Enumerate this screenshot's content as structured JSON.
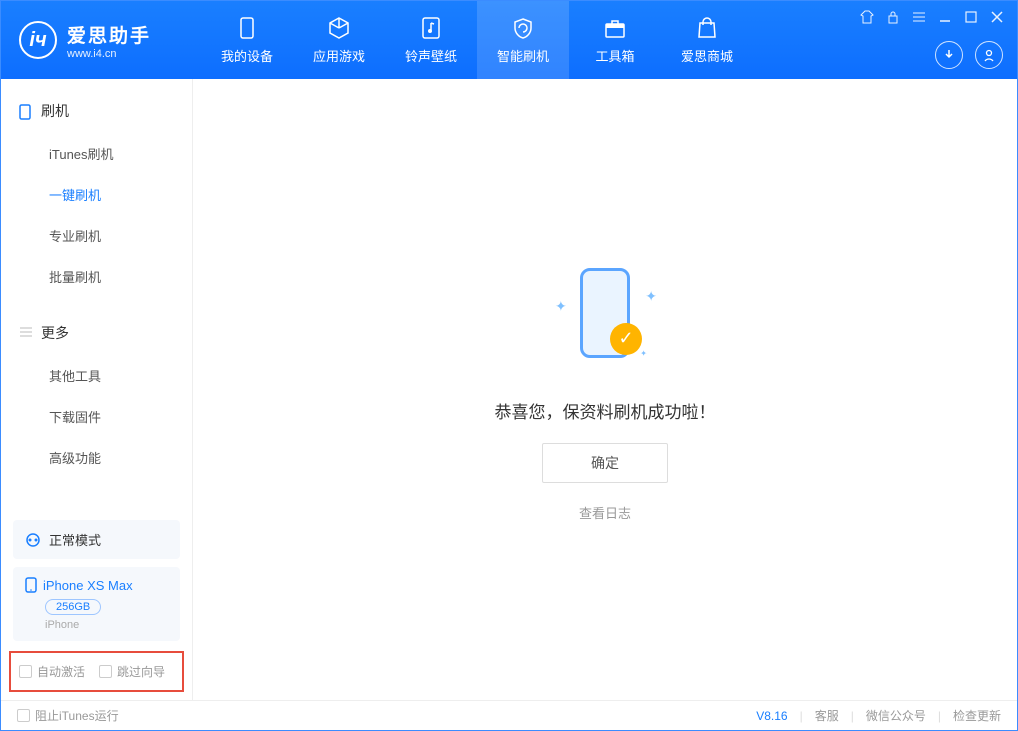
{
  "app": {
    "title": "爱思助手",
    "subtitle": "www.i4.cn"
  },
  "tabs": [
    {
      "label": "我的设备"
    },
    {
      "label": "应用游戏"
    },
    {
      "label": "铃声壁纸"
    },
    {
      "label": "智能刷机"
    },
    {
      "label": "工具箱"
    },
    {
      "label": "爱思商城"
    }
  ],
  "sidebar": {
    "section1": {
      "title": "刷机",
      "items": [
        {
          "label": "iTunes刷机"
        },
        {
          "label": "一键刷机"
        },
        {
          "label": "专业刷机"
        },
        {
          "label": "批量刷机"
        }
      ]
    },
    "section2": {
      "title": "更多",
      "items": [
        {
          "label": "其他工具"
        },
        {
          "label": "下载固件"
        },
        {
          "label": "高级功能"
        }
      ]
    },
    "mode": "正常模式",
    "device": {
      "name": "iPhone XS Max",
      "capacity": "256GB",
      "type": "iPhone"
    },
    "options": {
      "auto_activate": "自动激活",
      "skip_guide": "跳过向导"
    }
  },
  "main": {
    "success_message": "恭喜您，保资料刷机成功啦！",
    "confirm": "确定",
    "view_log": "查看日志"
  },
  "footer": {
    "block_itunes": "阻止iTunes运行",
    "version": "V8.16",
    "links": {
      "support": "客服",
      "wechat": "微信公众号",
      "update": "检查更新"
    }
  }
}
